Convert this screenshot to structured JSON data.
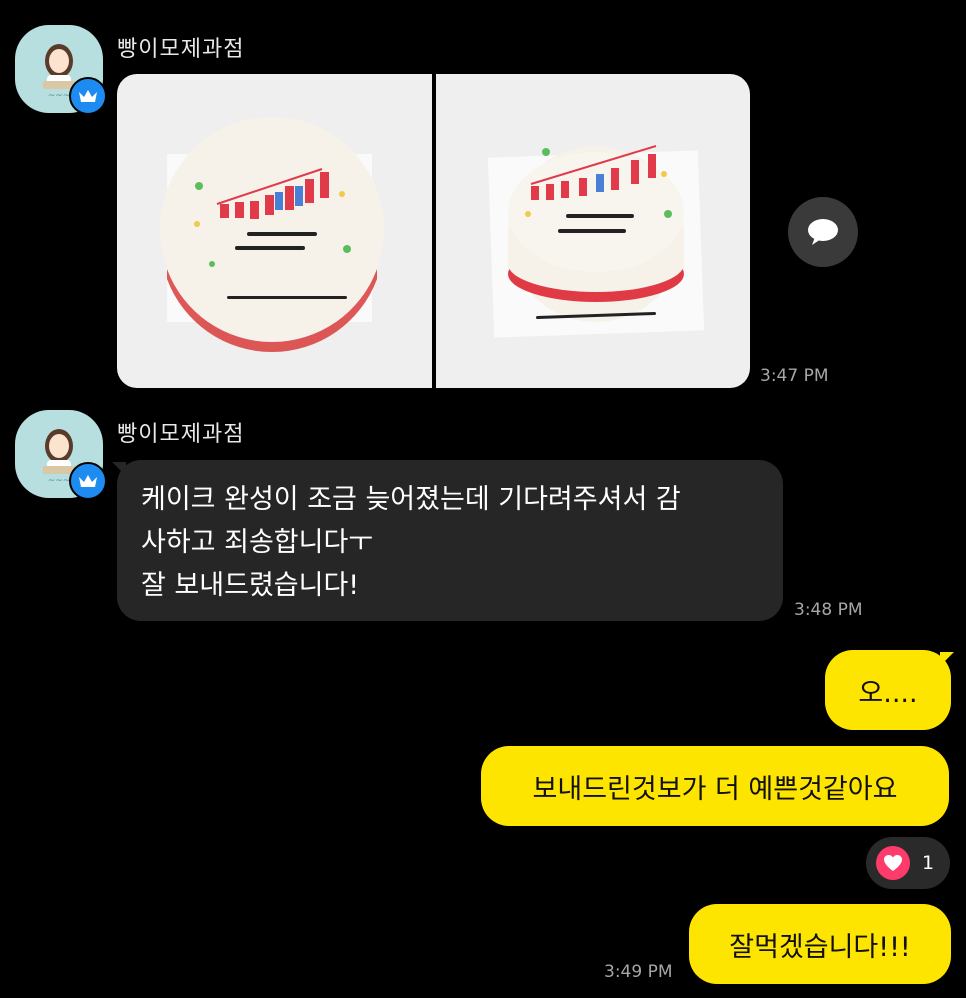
{
  "messages": {
    "first": {
      "sender": "빵이모제과점",
      "time": "3:47 PM",
      "photos": [
        {
          "description": "cake-photo-1"
        },
        {
          "description": "cake-photo-2"
        }
      ]
    },
    "second": {
      "sender": "빵이모제과점",
      "lines": [
        "케이크 완성이 조금 늦어졌는데 기다려주셔서 감",
        "사하고  죄송합니다ㅜ",
        "잘 보내드렸습니다!"
      ],
      "time": "3:48 PM"
    },
    "out1": "오....",
    "out2": "보내드린것보가 더 예쁜것같아요",
    "out2_reaction_count": "1",
    "out3": "잘먹겠습니다!!!",
    "out_time": "3:49 PM"
  },
  "colors": {
    "background": "#000000",
    "incoming_bubble": "#262626",
    "outgoing_bubble": "#fee500",
    "badge": "#1d8bf0",
    "reaction_heart": "#ff3b6b"
  },
  "icons": {
    "badge": "crown-icon",
    "share": "chat-bubble-icon",
    "reaction": "heart-icon"
  }
}
